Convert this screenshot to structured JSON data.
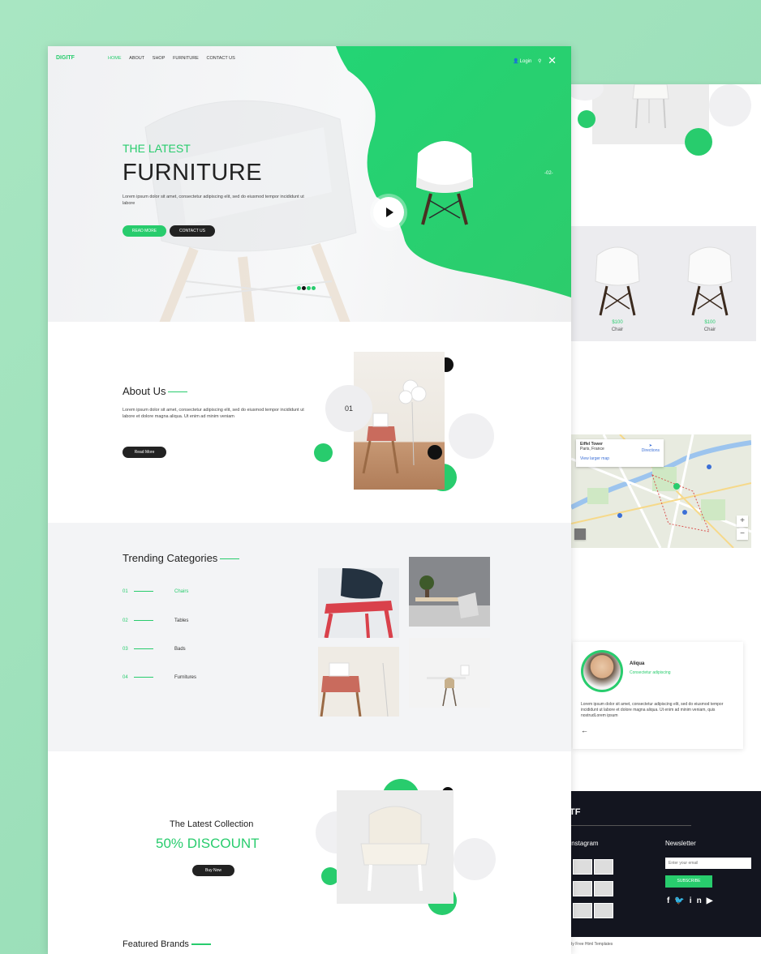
{
  "colors": {
    "accent": "#28cc6d",
    "dark": "#222222",
    "background": "#9bdfb9",
    "footer": "#13151f"
  },
  "header": {
    "logo": "DIGITF",
    "menu": [
      "HOME",
      "ABOUT",
      "SHOP",
      "FURNITURE",
      "CONTACT US"
    ],
    "active_menu": "HOME",
    "login": "Login",
    "icons": [
      "user-icon",
      "search-icon",
      "close-icon"
    ]
  },
  "hero": {
    "subtitle": "THE LATEST",
    "title": "FURNITURE",
    "description": "Lorem ipsum dolor sit amet, consectetur adipiscing elit, sed do eiusmod tempor incididunt ut labore",
    "read_more": "READ MORE",
    "contact": "CONTACT US",
    "slide_number": "-02-"
  },
  "about": {
    "title": "About Us",
    "description": "Lorem ipsum dolor sit amet, consectetur adipiscing elit, sed do eiusmod tempor incididunt ut labore et dolore magna aliqua. Ut enim ad minim veniam",
    "button": "Read More",
    "number": "01"
  },
  "trending": {
    "title": "Trending Categories",
    "categories": [
      {
        "num": "01",
        "label": "Chairs"
      },
      {
        "num": "02",
        "label": "Tables"
      },
      {
        "num": "03",
        "label": "Bads"
      },
      {
        "num": "04",
        "label": "Furnitures"
      }
    ]
  },
  "latest": {
    "title": "The Latest Collection",
    "discount": "50% DISCOUNT",
    "button": "Buy Now"
  },
  "featured": {
    "title": "Featured Brands"
  },
  "products": [
    {
      "price": "$100",
      "name": "Chair"
    },
    {
      "price": "$100",
      "name": "Chair"
    }
  ],
  "map": {
    "place": "Eiffel Tower",
    "address": "Paris, France",
    "directions": "Directions",
    "link": "View larger map"
  },
  "testimonial": {
    "name": "Aliqua",
    "role": "Consectetur adipiscing",
    "text": "Lorem ipsum dolor sit amet, consectetur adipiscing elit, sed do eiusmod tempor incididunt ut labore et dolore magna aliqua. Ut enim ad minim veniam, quis nostrudLorem ipsum"
  },
  "footer": {
    "brand": "TF",
    "instagram": "Instagram",
    "newsletter": "Newsletter",
    "email_placeholder": "Enter your email",
    "subscribe": "SUBSCRIBE",
    "social": "f  in ",
    "credit": "By Free Html Templates"
  }
}
